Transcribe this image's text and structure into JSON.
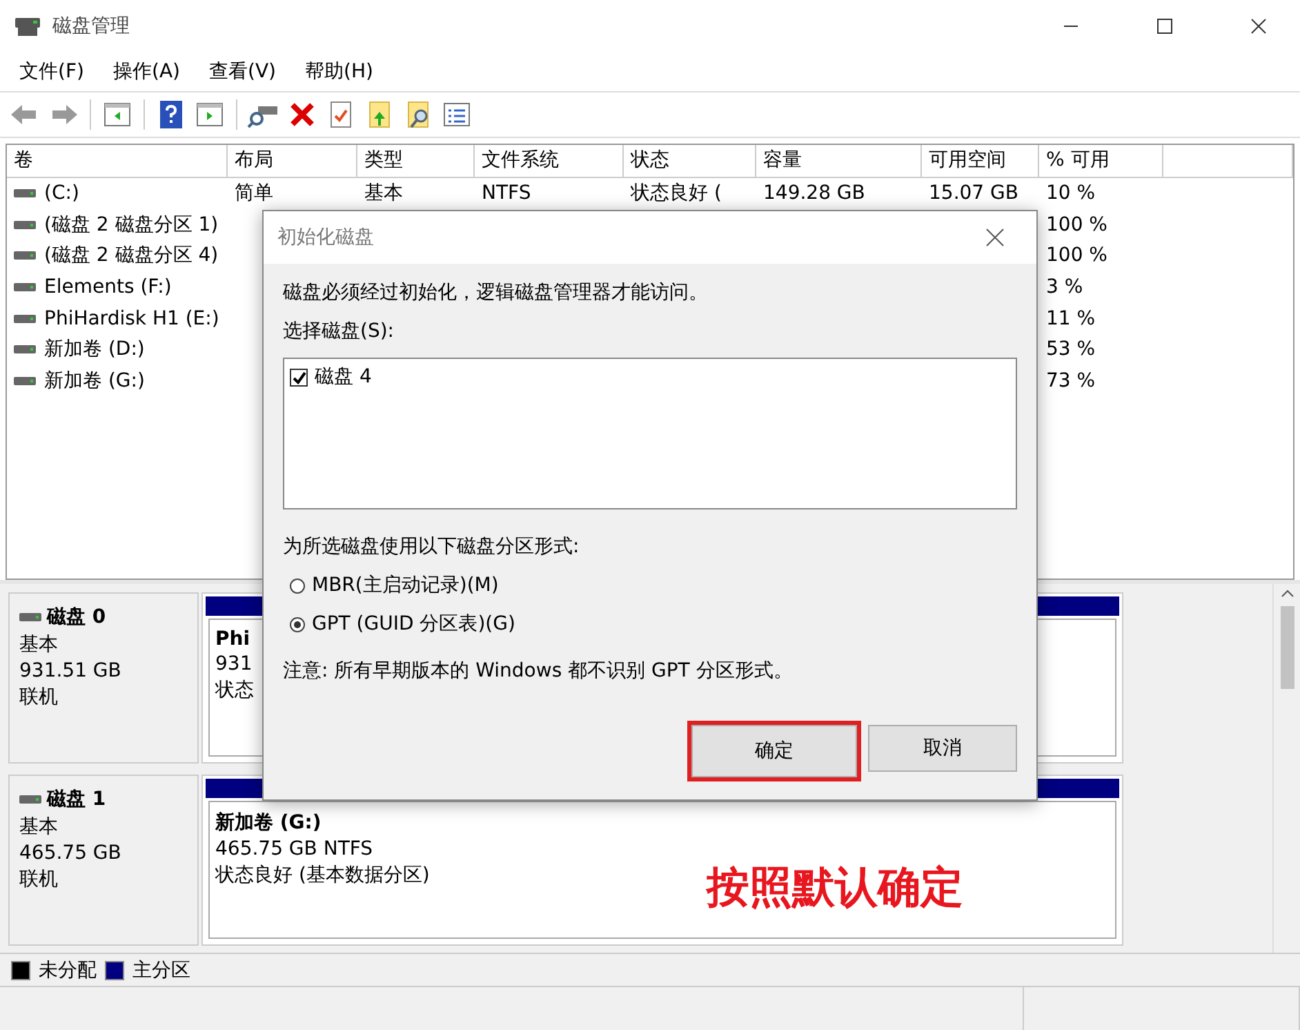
{
  "window": {
    "title": "磁盘管理"
  },
  "menu": [
    "文件(F)",
    "操作(A)",
    "查看(V)",
    "帮助(H)"
  ],
  "volume_table": {
    "columns": [
      "卷",
      "布局",
      "类型",
      "文件系统",
      "状态",
      "容量",
      "可用空间",
      "% 可用"
    ],
    "rows": [
      [
        "(C:)",
        "简单",
        "基本",
        "NTFS",
        "状态良好 (",
        "149.28 GB",
        "15.07 GB",
        "10 %"
      ],
      [
        "(磁盘 2 磁盘分区 1)",
        null,
        null,
        null,
        null,
        null,
        null,
        "100 %"
      ],
      [
        "(磁盘 2 磁盘分区 4)",
        null,
        null,
        null,
        null,
        null,
        null,
        "100 %"
      ],
      [
        "Elements (F:)",
        null,
        null,
        null,
        null,
        null,
        null,
        "3 %"
      ],
      [
        "PhiHardisk H1 (E:)",
        null,
        null,
        null,
        null,
        null,
        null,
        "11 %"
      ],
      [
        "新加卷 (D:)",
        null,
        null,
        null,
        null,
        null,
        null,
        "53 %"
      ],
      [
        "新加卷 (G:)",
        null,
        null,
        null,
        null,
        null,
        null,
        "73 %"
      ]
    ]
  },
  "disks": [
    {
      "name": "磁盘 0",
      "type": "基本",
      "size": "931.51 GB",
      "status": "联机",
      "partition": {
        "color": "#000080",
        "lines": [
          "Phi",
          "931",
          "状态"
        ]
      }
    },
    {
      "name": "磁盘 1",
      "type": "基本",
      "size": "465.75 GB",
      "status": "联机",
      "partition": {
        "color": "#000080",
        "lines": [
          "新加卷 (G:)",
          "465.75 GB NTFS",
          "状态良好 (基本数据分区)"
        ]
      }
    }
  ],
  "legend": [
    {
      "label": "未分配",
      "color": "#000000"
    },
    {
      "label": "主分区",
      "color": "#000080"
    }
  ],
  "dialog": {
    "title": "初始化磁盘",
    "message": "磁盘必须经过初始化，逻辑磁盘管理器才能访问。",
    "select_label": "选择磁盘(S):",
    "disks": [
      {
        "label": "磁盘 4",
        "checked": true
      }
    ],
    "style_label": "为所选磁盘使用以下磁盘分区形式:",
    "styles": [
      {
        "label": "MBR(主启动记录)(M)",
        "selected": false
      },
      {
        "label": "GPT (GUID 分区表)(G)",
        "selected": true
      }
    ],
    "note": "注意: 所有早期版本的 Windows 都不识别 GPT 分区形式。",
    "buttons": [
      {
        "label": "确定",
        "highlighted": true
      },
      {
        "label": "取消",
        "highlighted": false
      }
    ]
  },
  "annotation": "按照默认确定"
}
